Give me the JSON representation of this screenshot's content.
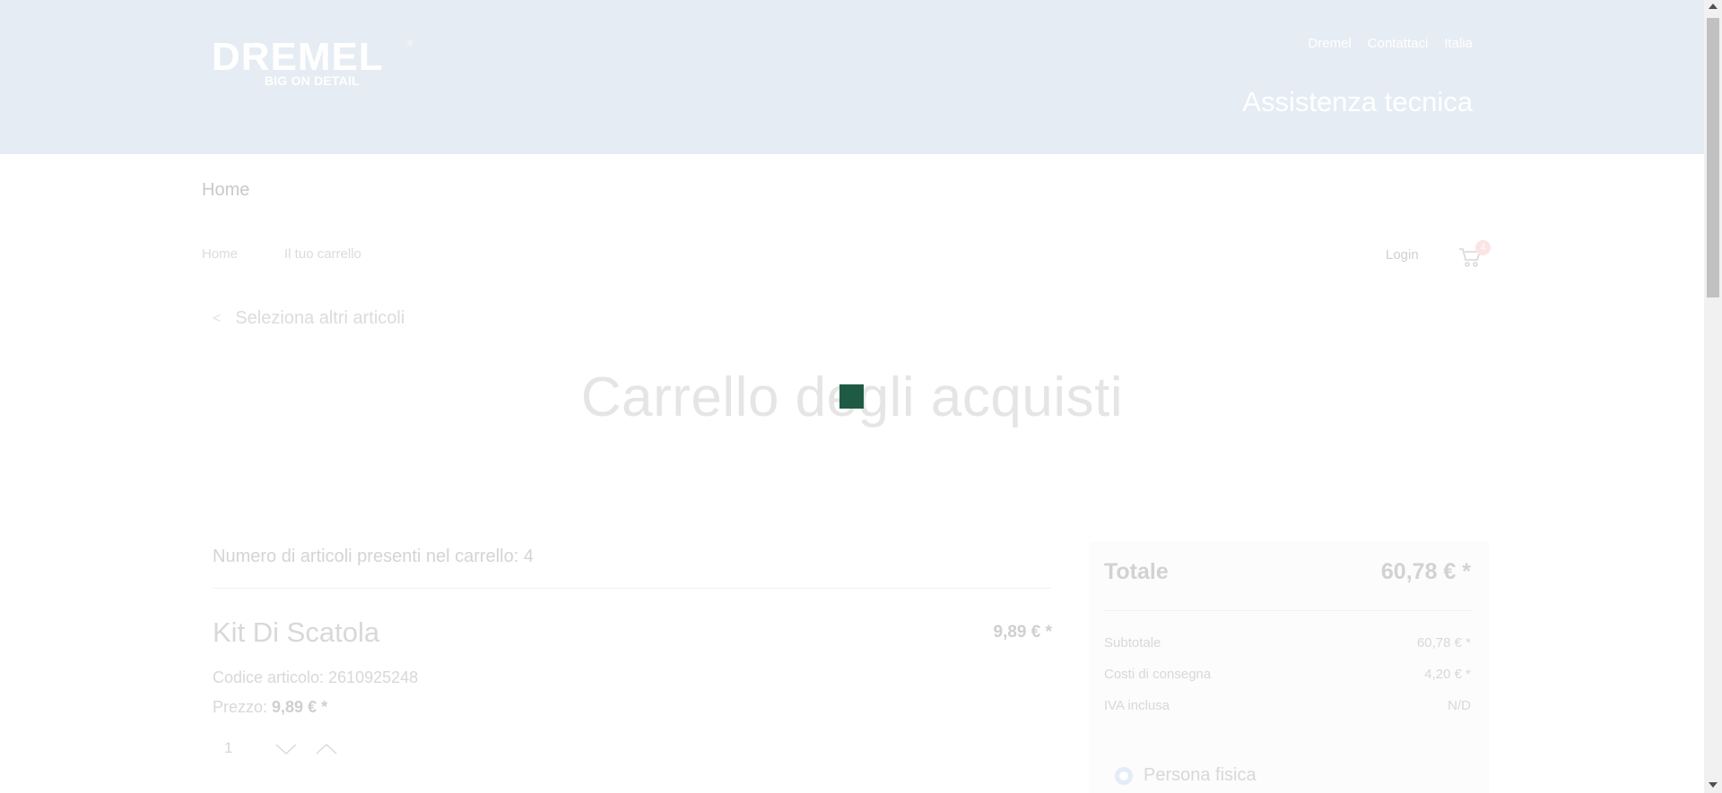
{
  "header": {
    "logo": {
      "brand": "DREMEL",
      "reg_mark": "®",
      "tagline": "BIG ON DETAIL"
    },
    "links": [
      "Dremel",
      "Contattaci",
      "Italia"
    ],
    "section_title": "Assistenza tecnica"
  },
  "nav": {
    "home": "Home"
  },
  "breadcrumb": [
    "Home",
    "Il tuo carrello"
  ],
  "account": {
    "login": "Login",
    "cart_count": "4"
  },
  "back_link": {
    "chevron": "<",
    "label": "Seleziona altri articoli"
  },
  "page_title": "Carrello degli acquisti",
  "cart": {
    "items_count_text": "Numero di articoli presenti nel carrello: 4",
    "items": [
      {
        "name": "Kit Di Scatola",
        "price": "9,89  € *",
        "code_label": "Codice articolo: 2610925248",
        "unit_price_label": "Prezzo: ",
        "unit_price": "9,89  € *",
        "quantity": "1"
      }
    ]
  },
  "summary": {
    "total_label": "Totale",
    "total_value": "60,78  € *",
    "rows": [
      {
        "label": "Subtotale",
        "value": "60,78  € *"
      },
      {
        "label": "Costi di consegna",
        "value": "4,20  € *"
      },
      {
        "label": "IVA inclusa",
        "value": "N/D"
      }
    ],
    "customer_type": "Persona fisica"
  },
  "colors": {
    "header_bg": "#e6ecf3",
    "loader": "#1e5a44"
  }
}
